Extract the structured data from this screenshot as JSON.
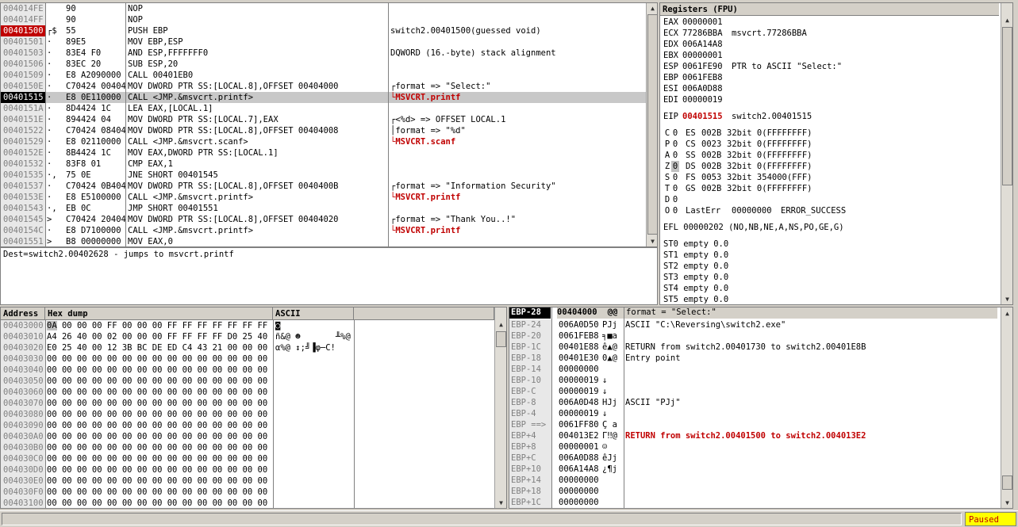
{
  "disasm": {
    "rows": [
      {
        "addr": "004014FE",
        "mark": "",
        "hex": "90",
        "cmd": "NOP",
        "comment": "",
        "hl": ""
      },
      {
        "addr": "004014FF",
        "mark": "",
        "hex": "90",
        "cmd": "NOP",
        "comment": "",
        "hl": ""
      },
      {
        "addr": "00401500",
        "mark": "┌$",
        "hex": "55",
        "cmd": "PUSH EBP",
        "comment": "switch2.00401500(guessed void)",
        "hl": "addr-red"
      },
      {
        "addr": "00401501",
        "mark": "·",
        "hex": "89E5",
        "cmd": "MOV EBP,ESP",
        "comment": "",
        "hl": ""
      },
      {
        "addr": "00401503",
        "mark": "·",
        "hex": "83E4 F0",
        "cmd": "AND ESP,FFFFFFF0",
        "comment": "DQWORD (16.-byte) stack alignment",
        "hl": ""
      },
      {
        "addr": "00401506",
        "mark": "·",
        "hex": "83EC 20",
        "cmd": "SUB ESP,20",
        "comment": "",
        "hl": ""
      },
      {
        "addr": "00401509",
        "mark": "·",
        "hex": "E8 A2090000",
        "cmd": "CALL 00401EB0",
        "comment": "",
        "hl": ""
      },
      {
        "addr": "0040150E",
        "mark": "·",
        "hex": "C70424 00404(",
        "cmd": "MOV DWORD PTR SS:[LOCAL.8],OFFSET 00404000",
        "comment": "┌format => \"Select:\"",
        "hl": ""
      },
      {
        "addr": "00401515",
        "mark": "·",
        "hex": "E8 0E110000",
        "cmd": "CALL <JMP.&msvcrt.printf>",
        "comment": "└MSVCRT.printf",
        "hl": "current"
      },
      {
        "addr": "0040151A",
        "mark": "·",
        "hex": "8D4424 1C",
        "cmd": "LEA EAX,[LOCAL.1]",
        "comment": "",
        "hl": ""
      },
      {
        "addr": "0040151E",
        "mark": "·",
        "hex": "894424 04",
        "cmd": "MOV DWORD PTR SS:[LOCAL.7],EAX",
        "comment": "┌<%d> => OFFSET LOCAL.1",
        "hl": ""
      },
      {
        "addr": "00401522",
        "mark": "·",
        "hex": "C70424 08404(",
        "cmd": "MOV DWORD PTR SS:[LOCAL.8],OFFSET 00404008",
        "comment": "│format => \"%d\"",
        "hl": ""
      },
      {
        "addr": "00401529",
        "mark": "·",
        "hex": "E8 02110000",
        "cmd": "CALL <JMP.&msvcrt.scanf>",
        "comment": "└MSVCRT.scanf",
        "hl": ""
      },
      {
        "addr": "0040152E",
        "mark": "·",
        "hex": "8B4424 1C",
        "cmd": "MOV EAX,DWORD PTR SS:[LOCAL.1]",
        "comment": "",
        "hl": ""
      },
      {
        "addr": "00401532",
        "mark": "·",
        "hex": "83F8 01",
        "cmd": "CMP EAX,1",
        "comment": "",
        "hl": ""
      },
      {
        "addr": "00401535",
        "mark": "·,",
        "hex": "75 0E",
        "cmd": "JNE SHORT 00401545",
        "comment": "",
        "hl": ""
      },
      {
        "addr": "00401537",
        "mark": "·",
        "hex": "C70424 0B404(",
        "cmd": "MOV DWORD PTR SS:[LOCAL.8],OFFSET 0040400B",
        "comment": "┌format => \"Information Security\"",
        "hl": ""
      },
      {
        "addr": "0040153E",
        "mark": "·",
        "hex": "E8 E5100000",
        "cmd": "CALL <JMP.&msvcrt.printf>",
        "comment": "└MSVCRT.printf",
        "hl": ""
      },
      {
        "addr": "00401543",
        "mark": "·,",
        "hex": "EB 0C",
        "cmd": "JMP SHORT 00401551",
        "comment": "",
        "hl": ""
      },
      {
        "addr": "00401545",
        "mark": ">",
        "hex": "C70424 20404(",
        "cmd": "MOV DWORD PTR SS:[LOCAL.8],OFFSET 00404020",
        "comment": "┌format => \"Thank You..!\"",
        "hl": ""
      },
      {
        "addr": "0040154C",
        "mark": "·",
        "hex": "E8 D7100000",
        "cmd": "CALL <JMP.&msvcrt.printf>",
        "comment": "└MSVCRT.printf",
        "hl": ""
      },
      {
        "addr": "00401551",
        "mark": ">",
        "hex": "B8 00000000",
        "cmd": "MOV EAX,0",
        "comment": "",
        "hl": ""
      }
    ],
    "info": "Dest=switch2.00402628 - jumps to msvcrt.printf"
  },
  "registers": {
    "title": "Registers (FPU)",
    "gp": [
      {
        "name": "EAX",
        "val": "00000001",
        "note": ""
      },
      {
        "name": "ECX",
        "val": "77286BBA",
        "note": "msvcrt.77286BBA"
      },
      {
        "name": "EDX",
        "val": "006A14A8",
        "note": ""
      },
      {
        "name": "EBX",
        "val": "00000001",
        "note": ""
      },
      {
        "name": "ESP",
        "val": "0061FE90",
        "note": "PTR to ASCII \"Select:\""
      },
      {
        "name": "EBP",
        "val": "0061FEB8",
        "note": ""
      },
      {
        "name": "ESI",
        "val": "006A0D88",
        "note": ""
      },
      {
        "name": "EDI",
        "val": "00000019",
        "note": ""
      }
    ],
    "eip": {
      "name": "EIP",
      "val": "00401515",
      "note": "switch2.00401515"
    },
    "segs": [
      {
        "flag": "C",
        "fv": "0",
        "seg": "ES",
        "sel": "002B",
        "bits": "32bit 0(FFFFFFFF)"
      },
      {
        "flag": "P",
        "fv": "0",
        "seg": "CS",
        "sel": "0023",
        "bits": "32bit 0(FFFFFFFF)"
      },
      {
        "flag": "A",
        "fv": "0",
        "seg": "SS",
        "sel": "002B",
        "bits": "32bit 0(FFFFFFFF)"
      },
      {
        "flag": "Z",
        "fv": "0",
        "seg": "DS",
        "sel": "002B",
        "bits": "32bit 0(FFFFFFFF)"
      },
      {
        "flag": "S",
        "fv": "0",
        "seg": "FS",
        "sel": "0053",
        "bits": "32bit 354000(FFF)"
      },
      {
        "flag": "T",
        "fv": "0",
        "seg": "GS",
        "sel": "002B",
        "bits": "32bit 0(FFFFFFFF)"
      },
      {
        "flag": "D",
        "fv": "0",
        "seg": "",
        "sel": "",
        "bits": ""
      },
      {
        "flag": "O",
        "fv": "0",
        "seg": "LastErr",
        "sel": "00000000",
        "bits": "ERROR_SUCCESS"
      }
    ],
    "efl": "EFL 00000202 (NO,NB,NE,A,NS,PO,GE,G)",
    "fpu": [
      "ST0 empty 0.0",
      "ST1 empty 0.0",
      "ST2 empty 0.0",
      "ST3 empty 0.0",
      "ST4 empty 0.0",
      "ST5 empty 0.0"
    ]
  },
  "dump": {
    "headers": {
      "address": "Address",
      "hex": "Hex dump",
      "ascii": "ASCII"
    },
    "rows": [
      {
        "addr": "00403000",
        "hex": "0A 00 00 00 FF 00 00 00 FF FF FF FF FF FF FF FF",
        "ascii": "◙"
      },
      {
        "addr": "00403010",
        "hex": "A4 26 40 00 02 00 00 00 FF FF FF FF D0 25 40 00",
        "ascii": "ñ&@ ☻       ╨%@"
      },
      {
        "addr": "00403020",
        "hex": "E0 25 40 00 12 3B BC DE ED C4 43 21 00 00 00 00",
        "ascii": "α%@ ↕;╝▐φ─C!"
      },
      {
        "addr": "00403030",
        "hex": "00 00 00 00 00 00 00 00 00 00 00 00 00 00 00 00",
        "ascii": ""
      },
      {
        "addr": "00403040",
        "hex": "00 00 00 00 00 00 00 00 00 00 00 00 00 00 00 00",
        "ascii": ""
      },
      {
        "addr": "00403050",
        "hex": "00 00 00 00 00 00 00 00 00 00 00 00 00 00 00 00",
        "ascii": ""
      },
      {
        "addr": "00403060",
        "hex": "00 00 00 00 00 00 00 00 00 00 00 00 00 00 00 00",
        "ascii": ""
      },
      {
        "addr": "00403070",
        "hex": "00 00 00 00 00 00 00 00 00 00 00 00 00 00 00 00",
        "ascii": ""
      },
      {
        "addr": "00403080",
        "hex": "00 00 00 00 00 00 00 00 00 00 00 00 00 00 00 00",
        "ascii": ""
      },
      {
        "addr": "00403090",
        "hex": "00 00 00 00 00 00 00 00 00 00 00 00 00 00 00 00",
        "ascii": ""
      },
      {
        "addr": "004030A0",
        "hex": "00 00 00 00 00 00 00 00 00 00 00 00 00 00 00 00",
        "ascii": ""
      },
      {
        "addr": "004030B0",
        "hex": "00 00 00 00 00 00 00 00 00 00 00 00 00 00 00 00",
        "ascii": ""
      },
      {
        "addr": "004030C0",
        "hex": "00 00 00 00 00 00 00 00 00 00 00 00 00 00 00 00",
        "ascii": ""
      },
      {
        "addr": "004030D0",
        "hex": "00 00 00 00 00 00 00 00 00 00 00 00 00 00 00 00",
        "ascii": ""
      },
      {
        "addr": "004030E0",
        "hex": "00 00 00 00 00 00 00 00 00 00 00 00 00 00 00 00",
        "ascii": ""
      },
      {
        "addr": "004030F0",
        "hex": "00 00 00 00 00 00 00 00 00 00 00 00 00 00 00 00",
        "ascii": ""
      },
      {
        "addr": "00403100",
        "hex": "00 00 00 00 00 00 00 00 00 00 00 00 00 00 00 00",
        "ascii": ""
      }
    ]
  },
  "stack": {
    "header": {
      "off": "EBP-28",
      "val": "00404000",
      "asc": "@@",
      "comment": "format = \"Select:\""
    },
    "rows": [
      {
        "off": "EBP-24",
        "val": "006A0D50",
        "asc": "PJj",
        "comment": "ASCII \"C:\\Reversing\\switch2.exe\"",
        "red": false
      },
      {
        "off": "EBP-20",
        "val": "0061FEB8",
        "asc": "╕■a",
        "comment": "",
        "red": false
      },
      {
        "off": "EBP-1C",
        "val": "00401E88",
        "asc": "ê▲@",
        "comment": "RETURN from switch2.00401730 to switch2.00401E8B",
        "red": false
      },
      {
        "off": "EBP-18",
        "val": "00401E30",
        "asc": "0▲@",
        "comment": "Entry point",
        "red": false
      },
      {
        "off": "EBP-14",
        "val": "00000000",
        "asc": "",
        "comment": "",
        "red": false
      },
      {
        "off": "EBP-10",
        "val": "00000019",
        "asc": "↓",
        "comment": "",
        "red": false
      },
      {
        "off": "EBP-C",
        "val": "00000019",
        "asc": "↓",
        "comment": "",
        "red": false
      },
      {
        "off": "EBP-8",
        "val": "006A0D48",
        "asc": "HJj",
        "comment": "ASCII \"PJj\"",
        "red": false
      },
      {
        "off": "EBP-4",
        "val": "00000019",
        "asc": "↓",
        "comment": "",
        "red": false
      },
      {
        "off": "EBP ==>",
        "val": "0061FF80",
        "asc": "Ç a",
        "comment": "",
        "red": false
      },
      {
        "off": "EBP+4",
        "val": "004013E2",
        "asc": "Γ‼@",
        "comment": "RETURN from switch2.00401500 to switch2.004013E2",
        "red": true
      },
      {
        "off": "EBP+8",
        "val": "00000001",
        "asc": "☺",
        "comment": "",
        "red": false
      },
      {
        "off": "EBP+C",
        "val": "006A0D88",
        "asc": "êJj",
        "comment": "",
        "red": false
      },
      {
        "off": "EBP+10",
        "val": "006A14A8",
        "asc": "¿¶j",
        "comment": "",
        "red": false
      },
      {
        "off": "EBP+14",
        "val": "00000000",
        "asc": "",
        "comment": "",
        "red": false
      },
      {
        "off": "EBP+18",
        "val": "00000000",
        "asc": "",
        "comment": "",
        "red": false
      },
      {
        "off": "EBP+1C",
        "val": "00000000",
        "asc": "",
        "comment": "",
        "red": false
      }
    ]
  },
  "status": {
    "state": "Paused"
  }
}
